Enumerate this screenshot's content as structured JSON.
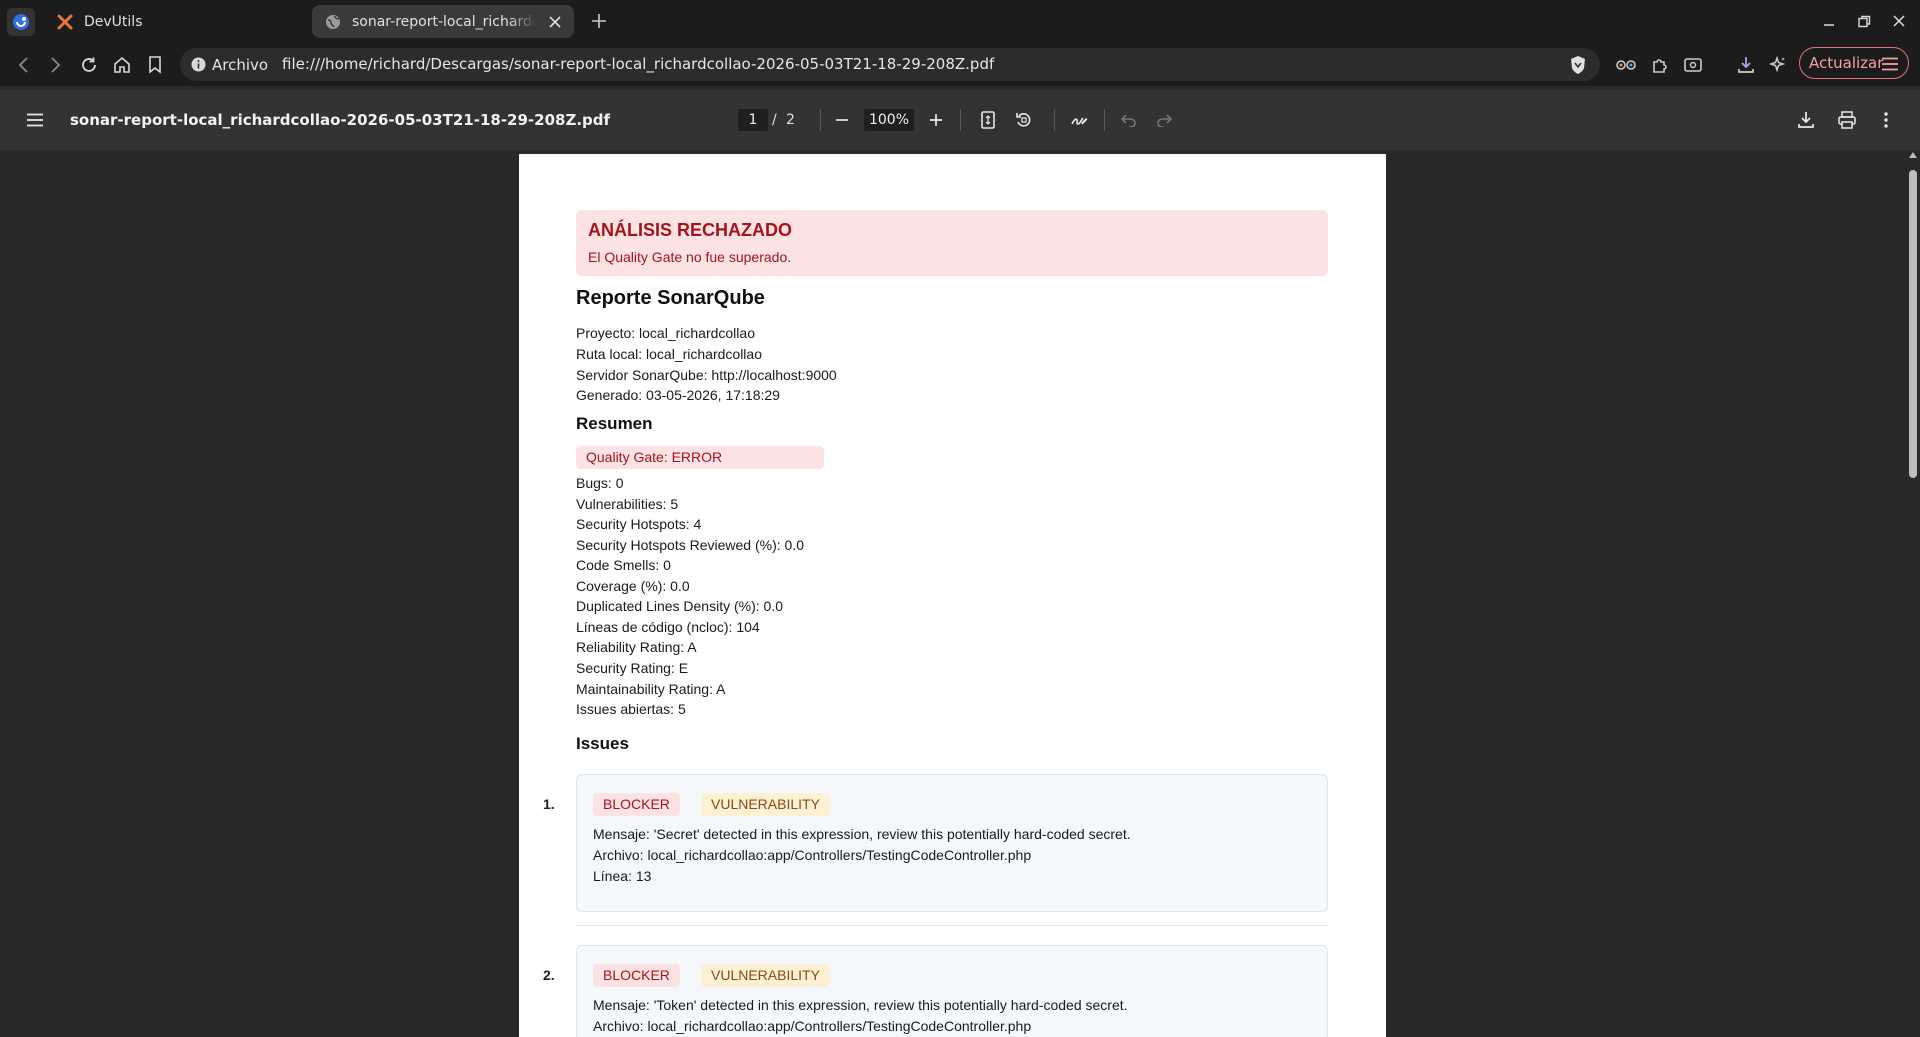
{
  "browser": {
    "tabs": [
      {
        "title": "DevUtils",
        "active": false
      },
      {
        "title": "sonar-report-local_richardcollao-2026-05-03T21-18-29-208Z.pdf",
        "active": true
      }
    ],
    "address": {
      "site_label": "Archivo",
      "url": "file:///home/richard/Descargas/sonar-report-local_richardcollao-2026-05-03T21-18-29-208Z.pdf"
    },
    "update_label": "Actualizar"
  },
  "pdf_viewer": {
    "filename": "sonar-report-local_richardcollao-2026-05-03T21-18-29-208Z.pdf",
    "page_current": "1",
    "page_separator": "/",
    "page_total": "2",
    "zoom": "100%"
  },
  "report": {
    "banner_title": "ANÁLISIS RECHAZADO",
    "banner_subtitle": "El Quality Gate no fue superado.",
    "title": "Reporte SonarQube",
    "meta": [
      "Proyecto: local_richardcollao",
      "Ruta local: local_richardcollao",
      "Servidor SonarQube: http://localhost:9000",
      "Generado: 03-05-2026, 17:18:29"
    ],
    "summary_title": "Resumen",
    "quality_gate": "Quality Gate: ERROR",
    "metrics": [
      "Bugs: 0",
      "Vulnerabilities: 5",
      "Security Hotspots: 4",
      "Security Hotspots Reviewed (%): 0.0",
      "Code Smells: 0",
      "Coverage (%): 0.0",
      "Duplicated Lines Density (%): 0.0",
      "Líneas de código (ncloc): 104",
      "Reliability Rating: A",
      "Security Rating: E",
      "Maintainability Rating: A",
      "Issues abiertas: 5"
    ],
    "issues_title": "Issues",
    "issues": [
      {
        "number": "1.",
        "severity": "BLOCKER",
        "type": "VULNERABILITY",
        "message": "Mensaje: 'Secret' detected in this expression, review this potentially hard-coded secret.",
        "file": "Archivo: local_richardcollao:app/Controllers/TestingCodeController.php",
        "line": "Línea: 13"
      },
      {
        "number": "2.",
        "severity": "BLOCKER",
        "type": "VULNERABILITY",
        "message": "Mensaje: 'Token' detected in this expression, review this potentially hard-coded secret.",
        "file": "Archivo: local_richardcollao:app/Controllers/TestingCodeController.php",
        "line": ""
      }
    ]
  }
}
